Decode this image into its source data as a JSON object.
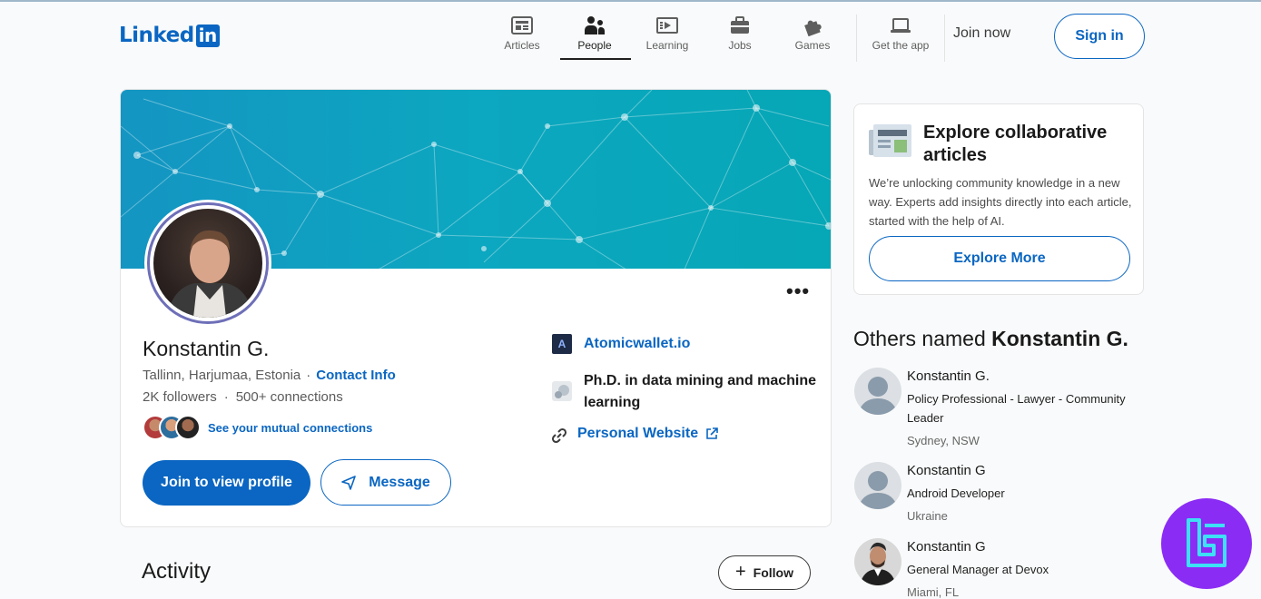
{
  "header": {
    "logo_word": "Linked",
    "logo_box": "in",
    "nav": [
      {
        "label": "Articles",
        "icon": "articles-icon"
      },
      {
        "label": "People",
        "icon": "people-icon",
        "active": true
      },
      {
        "label": "Learning",
        "icon": "learning-icon"
      },
      {
        "label": "Jobs",
        "icon": "jobs-icon"
      },
      {
        "label": "Games",
        "icon": "games-icon"
      },
      {
        "label": "Get the app",
        "icon": "laptop-icon"
      }
    ],
    "join_label": "Join now",
    "signin_label": "Sign in"
  },
  "profile": {
    "name": "Konstantin G.",
    "location": "Tallinn, Harjumaa, Estonia",
    "separator": "·",
    "contact_label": "Contact Info",
    "followers": "2K followers",
    "connections": "500+ connections",
    "mutual_label": "See your mutual connections",
    "join_button": "Join to view profile",
    "message_button": "Message",
    "more_label": "•••",
    "company_logo_text": "A",
    "company": "Atomicwallet.io",
    "education": "Ph.D. in data mining and machine learning",
    "website": "Personal Website"
  },
  "activity": {
    "title": "Activity",
    "follow_label": "Follow",
    "follow_plus": "+"
  },
  "explore": {
    "title": "Explore collaborative articles",
    "description": "We’re unlocking community knowledge in a new way. Experts add insights directly into each article, started with the help of AI.",
    "button": "Explore More"
  },
  "others": {
    "title_prefix": "Others named",
    "title_name": "Konstantin G.",
    "people": [
      {
        "name": "Konstantin G.",
        "headline": "Policy Professional - Lawyer - Community Leader",
        "location": "Sydney, NSW"
      },
      {
        "name": "Konstantin G",
        "headline": "Android Developer",
        "location": "Ukraine"
      },
      {
        "name": "Konstantin G",
        "headline": "General Manager at Devox",
        "location": "Miami, FL"
      }
    ]
  },
  "colors": {
    "brand": "#0a66c2",
    "banner": "#0ca7c0",
    "badge": "#8b2cf5"
  }
}
